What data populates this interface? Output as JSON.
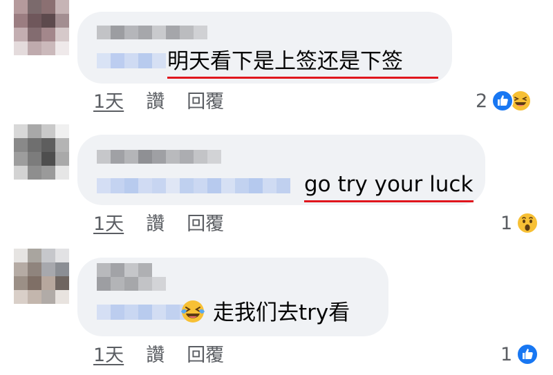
{
  "comments": [
    {
      "text": "明天看下是上签还是下签",
      "time": "1天",
      "like": "讚",
      "reply": "回覆",
      "reaction_count": "2",
      "reactions": [
        "like-icon",
        "haha-icon"
      ]
    },
    {
      "text": "go try your luck",
      "time": "1天",
      "like": "讚",
      "reply": "回覆",
      "reaction_count": "1",
      "reactions": [
        "wow-icon"
      ]
    },
    {
      "text": "走我们去try看",
      "emoji": "laughing-tears-emoji",
      "time": "1天",
      "like": "讚",
      "reply": "回覆",
      "reaction_count": "1",
      "reactions": [
        "like-icon"
      ]
    }
  ],
  "colors": {
    "bubble": "#f0f2f5",
    "underline": "#e0151c",
    "like_blue": "#1877f2",
    "emoji_yellow": "#f7c035",
    "meta_text": "#5a5d62"
  }
}
